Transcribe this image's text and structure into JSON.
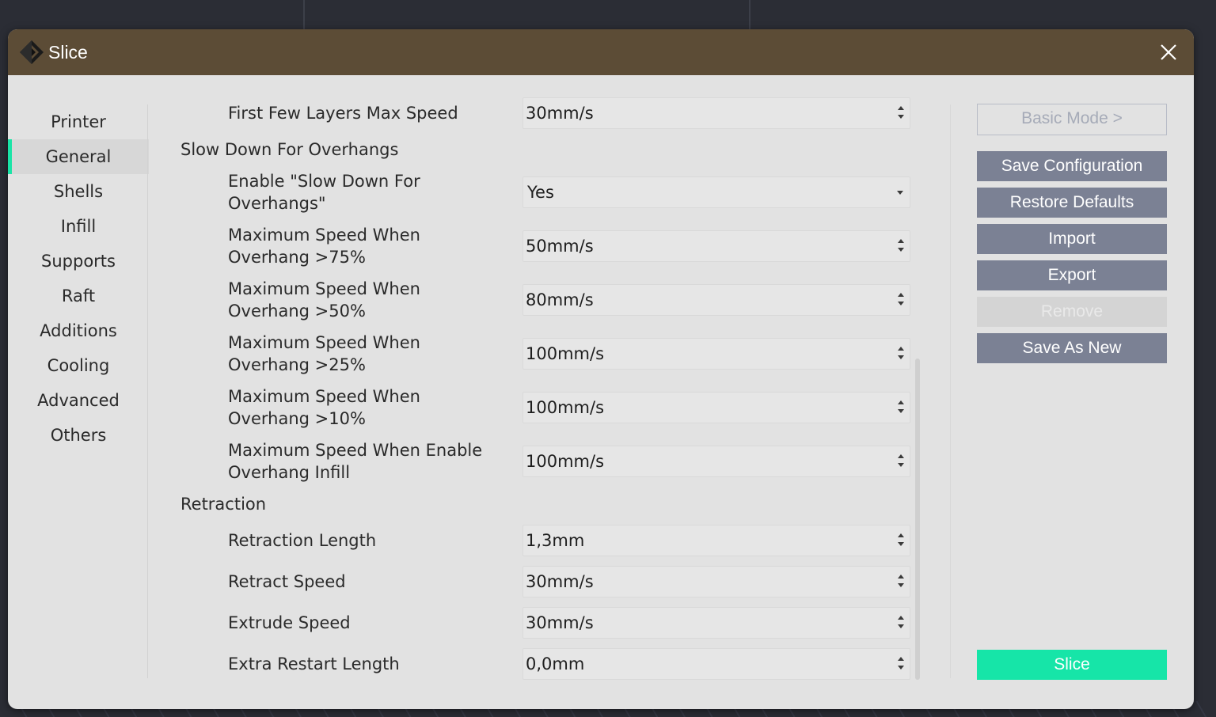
{
  "window": {
    "title": "Slice"
  },
  "sidebar": {
    "items": [
      {
        "label": "Printer",
        "active": false
      },
      {
        "label": "General",
        "active": true
      },
      {
        "label": "Shells",
        "active": false
      },
      {
        "label": "Infill",
        "active": false
      },
      {
        "label": "Supports",
        "active": false
      },
      {
        "label": "Raft",
        "active": false
      },
      {
        "label": "Additions",
        "active": false
      },
      {
        "label": "Cooling",
        "active": false
      },
      {
        "label": "Advanced",
        "active": false
      },
      {
        "label": "Others",
        "active": false
      }
    ]
  },
  "settings": {
    "first_few_layers_max_speed": {
      "label": "First Few Layers Max Speed",
      "value": "30mm/s"
    },
    "slow_down_section": "Slow Down For Overhangs",
    "enable_slow_down": {
      "label_line1": "Enable \"Slow Down For",
      "label_line2": "Overhangs\"",
      "value": "Yes"
    },
    "max_speed_75": {
      "label_line1": "Maximum Speed When",
      "label_line2": "Overhang >75%",
      "value": "50mm/s"
    },
    "max_speed_50": {
      "label_line1": "Maximum Speed When",
      "label_line2": "Overhang >50%",
      "value": "80mm/s"
    },
    "max_speed_25": {
      "label_line1": "Maximum Speed When",
      "label_line2": "Overhang >25%",
      "value": "100mm/s"
    },
    "max_speed_10": {
      "label_line1": "Maximum Speed When",
      "label_line2": "Overhang >10%",
      "value": "100mm/s"
    },
    "max_speed_infill": {
      "label_line1": "Maximum Speed When Enable",
      "label_line2": "Overhang Infill",
      "value": "100mm/s"
    },
    "retraction_section": "Retraction",
    "retraction_length": {
      "label": "Retraction Length",
      "value": "1,3mm"
    },
    "retract_speed": {
      "label": "Retract Speed",
      "value": "30mm/s"
    },
    "extrude_speed": {
      "label": "Extrude Speed",
      "value": "30mm/s"
    },
    "extra_restart_length": {
      "label": "Extra Restart Length",
      "value": "0,0mm"
    }
  },
  "buttons": {
    "basic_mode": "Basic Mode >",
    "save_configuration": "Save Configuration",
    "restore_defaults": "Restore Defaults",
    "import": "Import",
    "export": "Export",
    "remove": "Remove",
    "save_as_new": "Save As New",
    "slice": "Slice"
  },
  "colors": {
    "titlebar": "#5c4c36",
    "accent": "#1be4a7",
    "button": "#7b8194",
    "slice_button": "#16e5a8"
  },
  "icons": {
    "logo": "app-logo-icon",
    "close": "close-icon"
  }
}
